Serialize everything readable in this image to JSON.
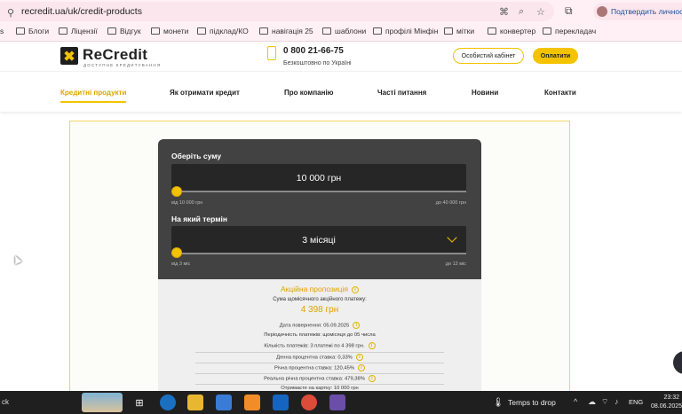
{
  "browser": {
    "url": "recredit.ua/uk/credit-products",
    "profile_label": "Подтвердить личность",
    "bookmarks": [
      "Блоги",
      "Ліцензії",
      "Відгук",
      "монети",
      "підклад/КО",
      "навігація 25",
      "шаблони",
      "профілі Мінфін",
      "мітки",
      "конвертер",
      "перекладач"
    ]
  },
  "header": {
    "logo_name": "ReCredit",
    "logo_tagline": "ДОСТУПНЕ КРЕДИТУВАННЯ",
    "phone": "0 800 21-66-75",
    "phone_note": "Безкоштовно по Україні",
    "cabinet_button": "Особистий кабінет",
    "pay_button": "Оплатити"
  },
  "nav": {
    "items": [
      "Кредитні продукти",
      "Як отримати кредит",
      "Про компанію",
      "Часті питання",
      "Новини",
      "Контакти"
    ],
    "active": 0
  },
  "calculator": {
    "amount_label": "Оберіть суму",
    "amount_value": "10 000 грн",
    "amount_min": "від 10 000 грн",
    "amount_max": "до 40 000 грн",
    "amount_fraction": 0,
    "term_label": "На який термін",
    "term_value": "3 місяці",
    "term_min": "від 3 міс",
    "term_max": "до 12 міс",
    "term_fraction": 0
  },
  "offer": {
    "title": "Акційна пропозиція",
    "monthly_label": "Сума щомісячного акційного платежу:",
    "monthly_amount": "4 398 грн",
    "details": [
      "Дата повернення: 05.09.2025",
      "Періодичність платежів: щомісяця до 05 числа",
      "Кількість платежів: 3 платежі по 4 398 грн.",
      "Денна процентна ставка: 0,33%",
      "Річна процентна ставка: 120,45%",
      "Реальна річна процентна ставка: 479,38%",
      "Отримаєте на картку: 10 000 грн"
    ]
  },
  "taskbar": {
    "left_text": "ck",
    "weather": "Temps to drop",
    "lang": "ENG",
    "time": "23:32",
    "date": "08.06.2025"
  }
}
